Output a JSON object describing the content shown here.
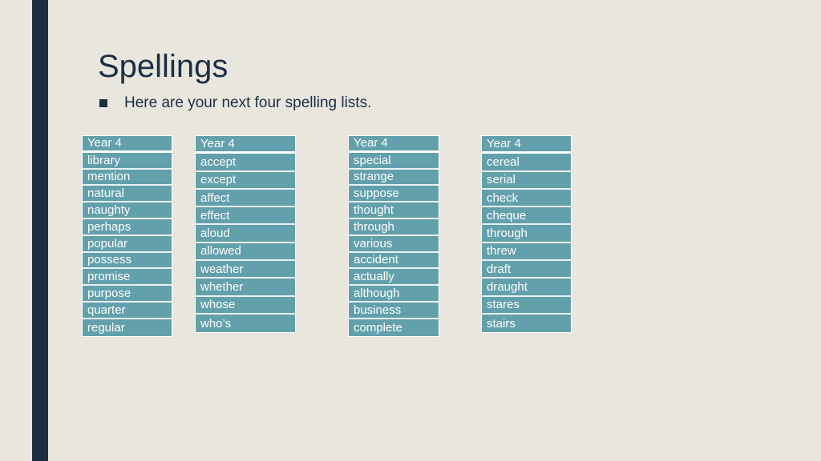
{
  "slide": {
    "title": "Spellings",
    "bullet": "Here are your next four spelling lists."
  },
  "lists": [
    {
      "header": "Year 4",
      "words": [
        "library",
        "mention",
        "natural",
        "naughty",
        "perhaps",
        "popular",
        "possess",
        "promise",
        "purpose",
        "quarter",
        "regular"
      ]
    },
    {
      "header": "Year 4",
      "words": [
        "accept",
        "except",
        "affect",
        "effect",
        "aloud",
        "allowed",
        "weather",
        "whether",
        "whose",
        "who’s"
      ]
    },
    {
      "header": "Year 4",
      "words": [
        "special",
        "strange",
        "suppose",
        "thought",
        "through",
        "various",
        "accident",
        "actually",
        "although",
        "business",
        "complete"
      ]
    },
    {
      "header": "Year 4",
      "words": [
        "cereal",
        "serial",
        "check",
        "cheque",
        "through",
        "threw",
        "draft",
        "draught",
        "stares",
        "stairs"
      ]
    }
  ],
  "colors": {
    "background": "#e8e6dd",
    "accent_bar": "#1c2e43",
    "cell": "#62a0ac",
    "text_dark": "#1c2e43"
  }
}
